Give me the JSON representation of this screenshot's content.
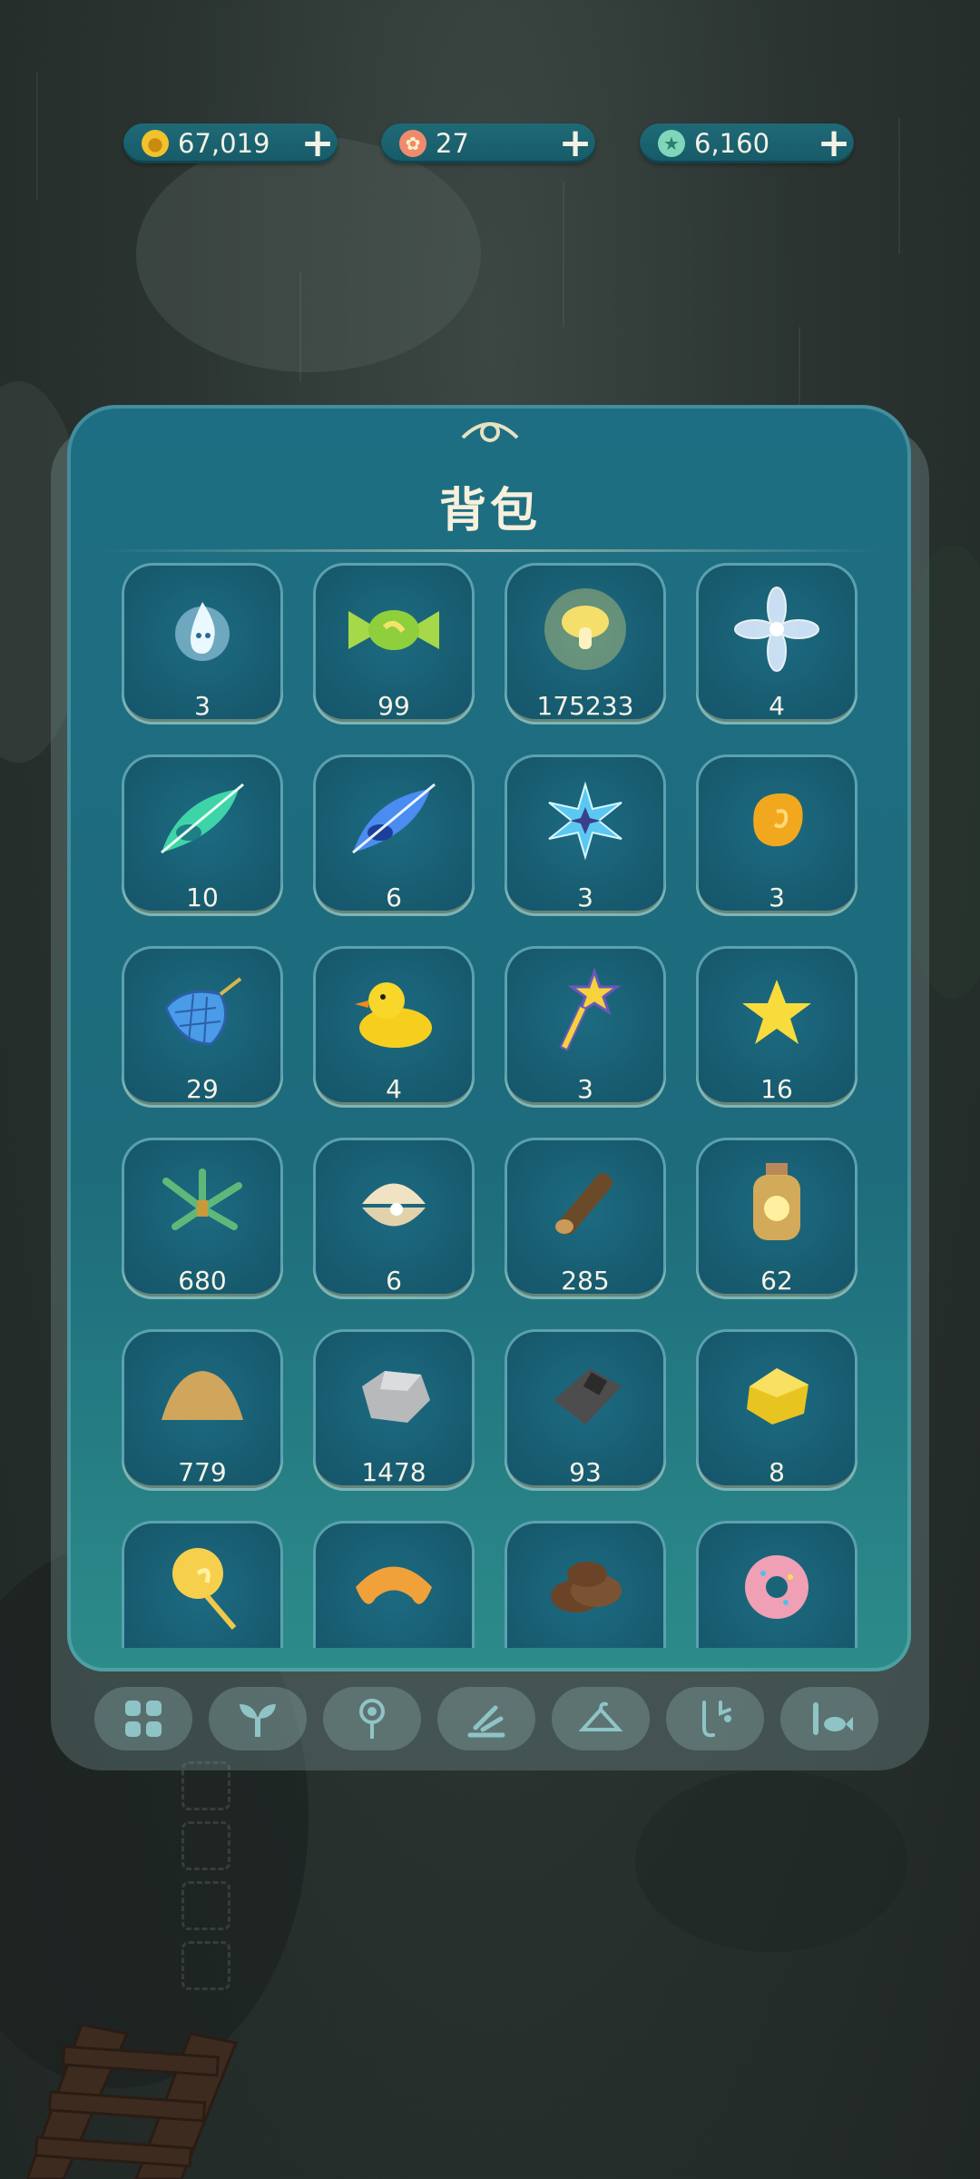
{
  "currencies": [
    {
      "name": "coins",
      "value": "67,019",
      "icon": "gold-coin-icon",
      "color": "#f2c12e"
    },
    {
      "name": "hearts",
      "value": "27",
      "icon": "flower-token-icon",
      "color": "#f08a6e"
    },
    {
      "name": "stars",
      "value": "6,160",
      "icon": "star-token-icon",
      "color": "#7fd6b8"
    }
  ],
  "panel": {
    "title": "背包"
  },
  "items": [
    {
      "name": "spirit-flame-icon",
      "count": "3"
    },
    {
      "name": "wrapped-candy-icon",
      "count": "99"
    },
    {
      "name": "glowing-mushroom-icon",
      "count": "175233"
    },
    {
      "name": "crystal-flower-icon",
      "count": "4"
    },
    {
      "name": "green-feather-icon",
      "count": "10"
    },
    {
      "name": "blue-feather-icon",
      "count": "6"
    },
    {
      "name": "star-crystal-icon",
      "count": "3"
    },
    {
      "name": "amber-gem-icon",
      "count": "3"
    },
    {
      "name": "bug-net-icon",
      "count": "29"
    },
    {
      "name": "rubber-duck-icon",
      "count": "4"
    },
    {
      "name": "star-key-icon",
      "count": "3"
    },
    {
      "name": "yellow-star-icon",
      "count": "16"
    },
    {
      "name": "grass-bundle-icon",
      "count": "680"
    },
    {
      "name": "pearl-shell-icon",
      "count": "6"
    },
    {
      "name": "wood-log-icon",
      "count": "285"
    },
    {
      "name": "firefly-jar-icon",
      "count": "62"
    },
    {
      "name": "sand-pile-icon",
      "count": "779"
    },
    {
      "name": "stone-icon",
      "count": "1478"
    },
    {
      "name": "iron-ore-icon",
      "count": "93"
    },
    {
      "name": "gold-nugget-icon",
      "count": "8"
    },
    {
      "name": "lollipop-icon",
      "count": ""
    },
    {
      "name": "croissant-icon",
      "count": ""
    },
    {
      "name": "cookies-icon",
      "count": ""
    },
    {
      "name": "donut-icon",
      "count": ""
    }
  ],
  "tabs": [
    {
      "name": "tab-all",
      "icon": "grid-icon"
    },
    {
      "name": "tab-plants",
      "icon": "sprout-icon"
    },
    {
      "name": "tab-flowers",
      "icon": "flower-icon"
    },
    {
      "name": "tab-tools",
      "icon": "tools-icon"
    },
    {
      "name": "tab-clothing",
      "icon": "hanger-icon"
    },
    {
      "name": "tab-music",
      "icon": "music-icon"
    },
    {
      "name": "tab-fishing",
      "icon": "fish-icon"
    }
  ]
}
